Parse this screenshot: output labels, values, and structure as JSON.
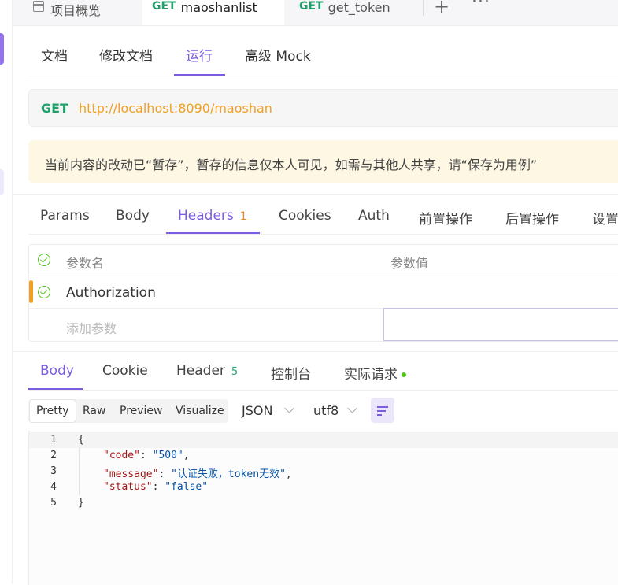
{
  "top_tabs": {
    "overview": "项目概览",
    "tab1_method": "GET",
    "tab1_name": "maoshanlist",
    "tab2_method": "GET",
    "tab2_name": "get_token",
    "add": "+",
    "more": "···"
  },
  "sub_tabs": {
    "doc": "文档",
    "edit": "修改文档",
    "run": "运行",
    "mock": "高级 Mock"
  },
  "url_bar": {
    "method": "GET",
    "url": "http://localhost:8090/maoshan"
  },
  "notice": "当前内容的改动已“暂存”，暂存的信息仅本人可见，如需与其他人共享，请“保存为用例”",
  "request_tabs": {
    "params": "Params",
    "body": "Body",
    "headers": "Headers",
    "headers_count": "1",
    "cookies": "Cookies",
    "auth": "Auth",
    "pre": "前置操作",
    "post": "后置操作",
    "settings": "设置"
  },
  "headers_table": {
    "col_name": "参数名",
    "col_value": "参数值",
    "row_name": "Authorization",
    "add_placeholder": "添加参数"
  },
  "response_tabs": {
    "body": "Body",
    "cookie": "Cookie",
    "header": "Header",
    "header_count": "5",
    "console": "控制台",
    "actual": "实际请求"
  },
  "view_toolbar": {
    "pretty": "Pretty",
    "raw": "Raw",
    "preview": "Preview",
    "visualize": "Visualize",
    "format": "JSON",
    "encoding": "utf8"
  },
  "code": {
    "line_numbers": [
      "1",
      "2",
      "3",
      "4",
      "5"
    ],
    "open": "{",
    "code_key": "\"code\"",
    "code_val": "\"500\"",
    "message_key": "\"message\"",
    "message_val": "\"认证失败，token无效\"",
    "status_key": "\"status\"",
    "status_val": "\"false\"",
    "close": "}"
  },
  "colors": {
    "accent": "#7c5ce0",
    "get_method": "#22a06b",
    "url": "#f0a020",
    "notice_bg": "#fdf7e4"
  }
}
